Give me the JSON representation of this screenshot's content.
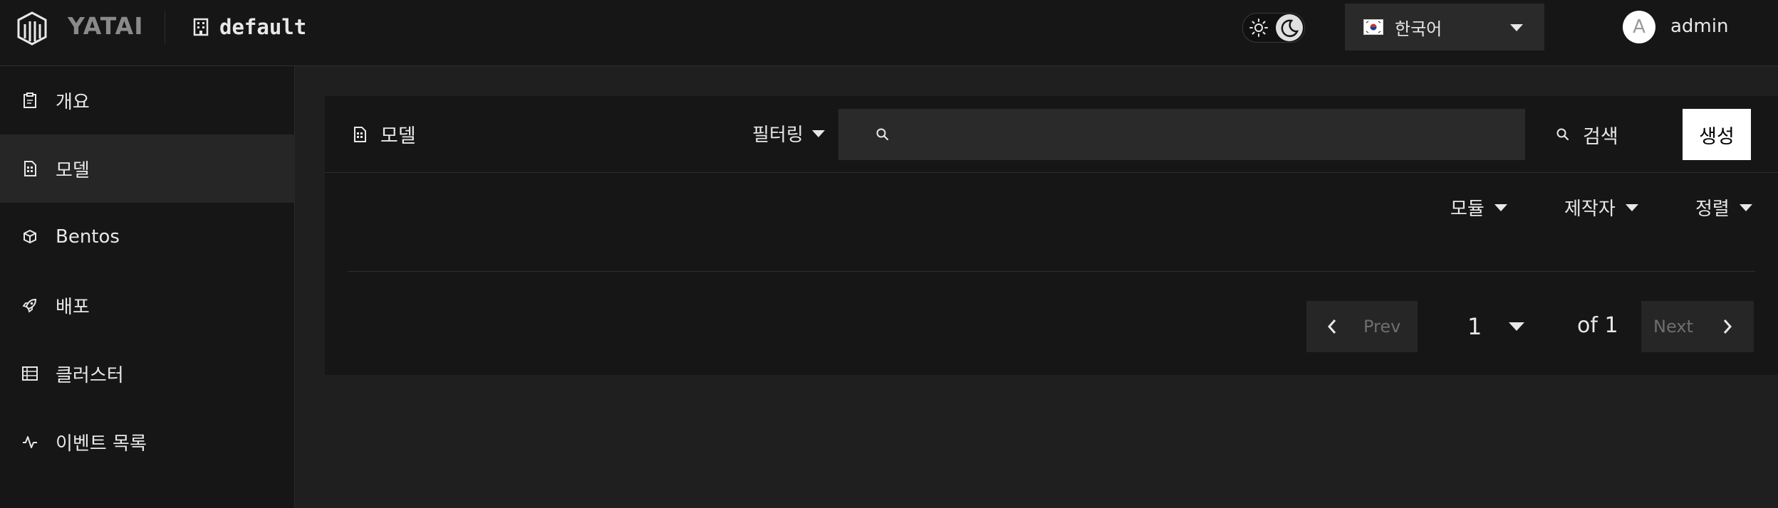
{
  "header": {
    "brand": "YATAI",
    "organization": "default",
    "language": {
      "selected": "한국어",
      "flag_icon": "south-korea-flag-icon"
    },
    "user": {
      "avatar_initial": "A",
      "name": "admin"
    }
  },
  "sidebar": {
    "items": [
      {
        "label": "개요",
        "icon": "clipboard-icon",
        "active": false
      },
      {
        "label": "모델",
        "icon": "file-icon",
        "active": true
      },
      {
        "label": "Bentos",
        "icon": "box-icon",
        "active": false
      },
      {
        "label": "배포",
        "icon": "rocket-icon",
        "active": false
      },
      {
        "label": "클러스터",
        "icon": "server-grid-icon",
        "active": false
      },
      {
        "label": "이벤트 목록",
        "icon": "activity-icon",
        "active": false
      }
    ]
  },
  "main": {
    "title": "모델",
    "filter_label": "필터링",
    "search": {
      "value": "",
      "placeholder": ""
    },
    "search_button": "검색",
    "create_button": "생성",
    "sort_bar": {
      "module": "모듈",
      "creator": "제작자",
      "sort": "정렬"
    },
    "pagination": {
      "prev": "Prev",
      "current_page": "1",
      "of": "of 1",
      "next": "Next"
    }
  },
  "colors": {
    "background": "#1f1f1f",
    "surface": "#161616",
    "input": "#2a2a2a",
    "text": "#e8e8e8",
    "muted": "#6e6e6e",
    "primary_button": "#ffffff"
  }
}
